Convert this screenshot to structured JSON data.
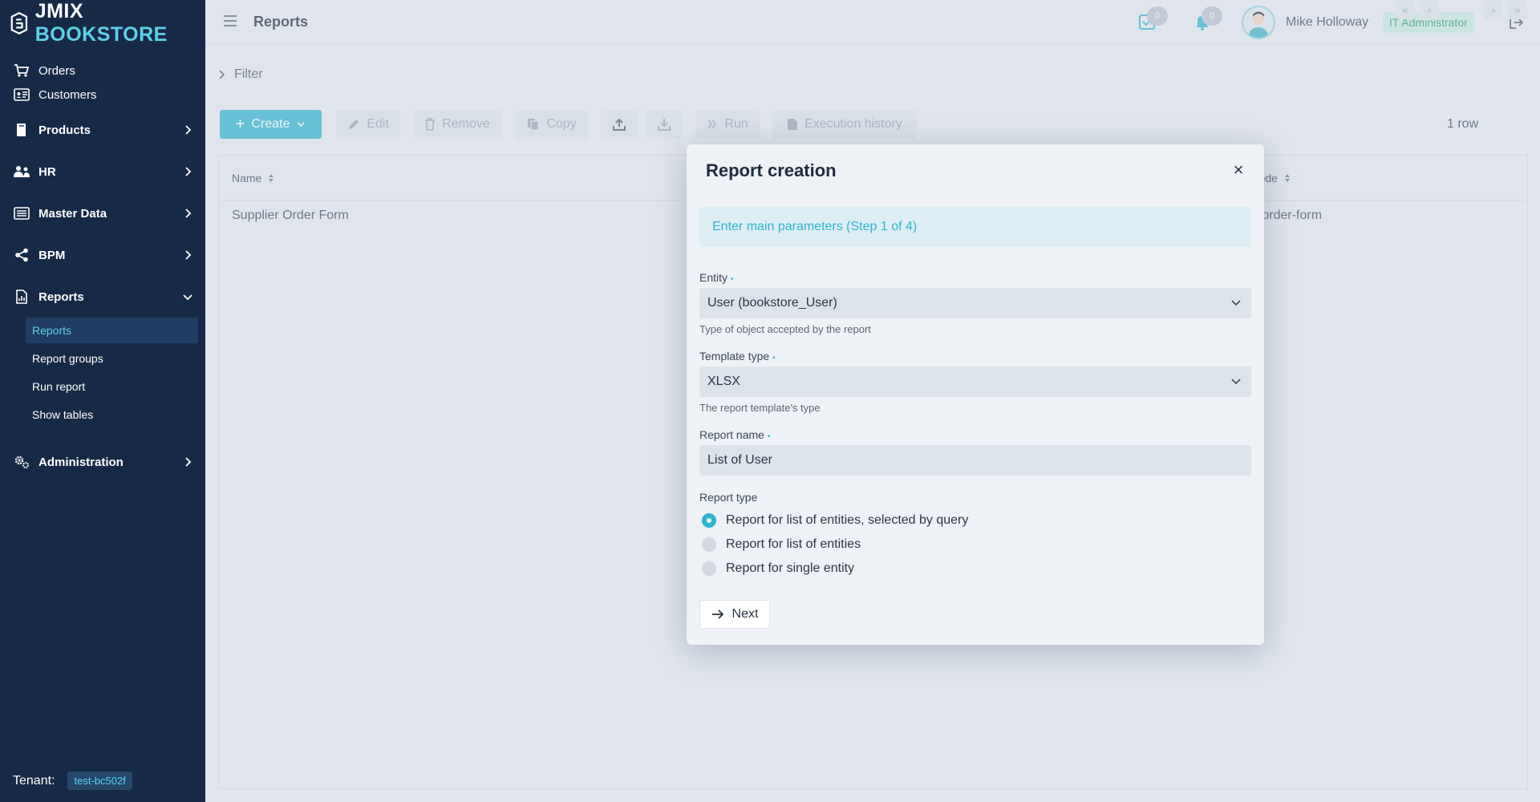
{
  "brand": {
    "part1": "JMIX",
    "part2": "BOOKSTORE"
  },
  "sidebar": {
    "items": [
      {
        "label": "Orders",
        "icon": "cart-icon"
      },
      {
        "label": "Customers",
        "icon": "id-card-icon"
      },
      {
        "label": "Products",
        "icon": "book-icon"
      },
      {
        "label": "HR",
        "icon": "users-icon"
      },
      {
        "label": "Master Data",
        "icon": "list-icon"
      },
      {
        "label": "BPM",
        "icon": "share-icon"
      },
      {
        "label": "Reports",
        "icon": "report-icon"
      },
      {
        "label": "Administration",
        "icon": "gears-icon"
      }
    ],
    "report_sub": [
      "Reports",
      "Report groups",
      "Run report",
      "Show tables"
    ],
    "tenant_label": "Tenant:",
    "tenant_value": "test-bc502f"
  },
  "header": {
    "title": "Reports",
    "tasks_count": "0",
    "notifications_count": "0",
    "user_name": "Mike Holloway",
    "role": "IT Administrator"
  },
  "content": {
    "filter_label": "Filter",
    "toolbar": {
      "create": "Create",
      "edit": "Edit",
      "remove": "Remove",
      "copy": "Copy",
      "run": "Run",
      "history": "Execution history"
    },
    "pager_label": "1 row",
    "columns": {
      "name": "Name",
      "system_code": "System code"
    },
    "rows": [
      {
        "name": "Supplier Order Form",
        "system_code": "supplier-order-form"
      }
    ]
  },
  "dialog": {
    "title": "Report creation",
    "step": "Enter main parameters (Step 1 of 4)",
    "entity_label": "Entity",
    "entity_value": "User (bookstore_User)",
    "entity_hint": "Type of object accepted by the report",
    "template_label": "Template type",
    "template_value": "XLSX",
    "template_hint": "The report template's type",
    "name_label": "Report name",
    "name_value": "List of User",
    "type_label": "Report type",
    "type_options": [
      "Report for list of entities, selected by query",
      "Report for list of entities",
      "Report for single entity"
    ],
    "selected_type_index": 0,
    "next": "Next"
  },
  "colors": {
    "sidebar_bg": "#162a47",
    "accent": "#2fb4cf",
    "role_bg": "#c8ede0"
  }
}
